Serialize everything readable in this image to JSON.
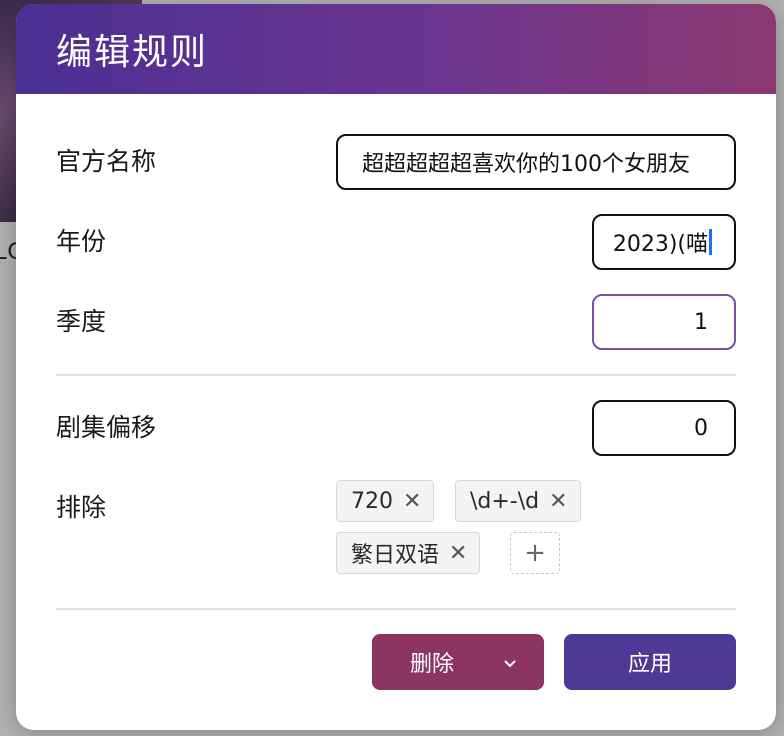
{
  "background": {
    "side_text": "LO"
  },
  "dialog": {
    "title": "编辑规则",
    "fields": {
      "official_name": {
        "label": "官方名称",
        "value": "超超超超超喜欢你的100个女朋友"
      },
      "year": {
        "label": "年份",
        "value": "2023)(喵"
      },
      "season": {
        "label": "季度",
        "value": "1"
      },
      "episode_offset": {
        "label": "剧集偏移",
        "value": "0"
      },
      "exclude": {
        "label": "排除",
        "tags": [
          "720",
          "\\d+-\\d",
          "繁日双语"
        ]
      }
    },
    "buttons": {
      "delete": "删除",
      "apply": "应用"
    }
  },
  "colors": {
    "header_start": "#4b2f93",
    "header_end": "#8b3870",
    "delete": "#8c3563",
    "apply": "#4e3a96",
    "focus_border": "#7a4fa8"
  },
  "icons": {
    "tag_remove": "close-icon",
    "add_tag": "plus-icon",
    "dropdown": "chevron-down-icon"
  }
}
